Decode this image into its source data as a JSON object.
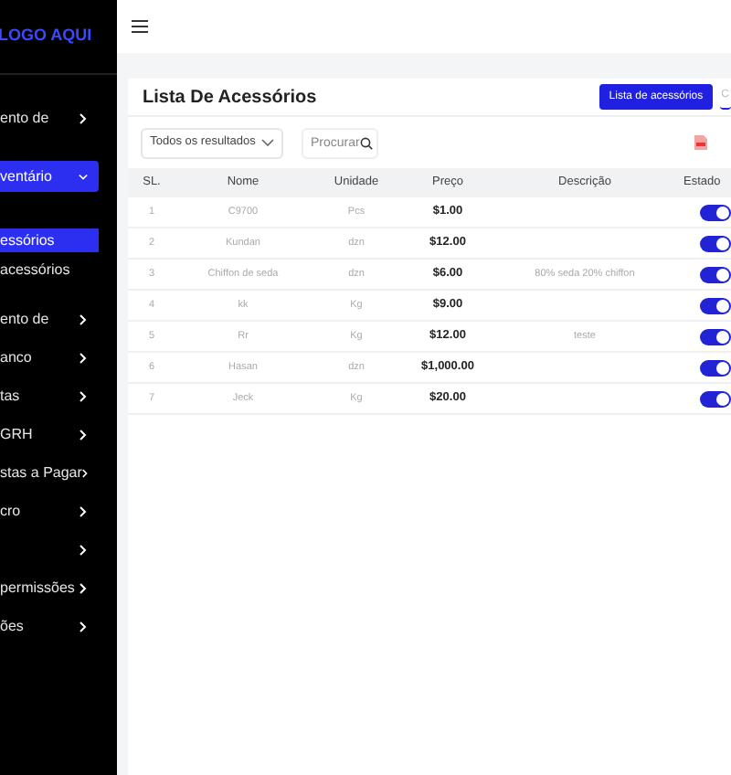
{
  "sidebar": {
    "logo": "LOGO AQUI",
    "items": [
      {
        "label": "ento de",
        "selected": false,
        "expanded": false
      },
      {
        "label": "ventário",
        "selected": true,
        "expanded": true,
        "children": [
          {
            "label": "essórios",
            "selected": true
          },
          {
            "label": "acessórios",
            "selected": false
          }
        ]
      },
      {
        "label": "ento de",
        "selected": false,
        "expanded": false
      },
      {
        "label": "anco",
        "selected": false,
        "expanded": false
      },
      {
        "label": "tas",
        "selected": false,
        "expanded": false
      },
      {
        "label": "GRH",
        "selected": false,
        "expanded": false
      },
      {
        "label": "stas a Pagar",
        "selected": false,
        "expanded": false
      },
      {
        "label": "cro",
        "selected": false,
        "expanded": false
      },
      {
        "selected": false,
        "expanded": false
      },
      {
        "label": "permissões",
        "selected": false,
        "expanded": false
      },
      {
        "label": "ões",
        "selected": false,
        "expanded": false
      }
    ]
  },
  "card": {
    "title": "Lista De Acessórios",
    "tabs": [
      {
        "label": "Lista de acessórios",
        "selected": true
      },
      {
        "label": "C",
        "selected": false
      }
    ],
    "filter": {
      "value": "Todos os resultados"
    },
    "search": {
      "placeholder": "Procurar"
    },
    "table": {
      "columns": [
        "SL.",
        "Nome",
        "Unidade",
        "Preço",
        "Descrição",
        "Estado"
      ],
      "rows": [
        {
          "sl": "1",
          "name": "C9700",
          "unit": "Pcs",
          "price": "$1.00",
          "description": "",
          "on": true
        },
        {
          "sl": "2",
          "name": "Kundan",
          "unit": "dzn",
          "price": "$12.00",
          "description": "",
          "on": true
        },
        {
          "sl": "3",
          "name": "Chiffon de seda",
          "unit": "dzn",
          "price": "$6.00",
          "description": "80% seda 20% chiffon",
          "on": true
        },
        {
          "sl": "4",
          "name": "kk",
          "unit": "Kg",
          "price": "$9.00",
          "description": "",
          "on": true
        },
        {
          "sl": "5",
          "name": "Rr",
          "unit": "Kg",
          "price": "$12.00",
          "description": "teste",
          "on": true
        },
        {
          "sl": "6",
          "name": "Hasan",
          "unit": "dzn",
          "price": "$1,000.00",
          "description": "",
          "on": true
        },
        {
          "sl": "7",
          "name": "Jeck",
          "unit": "Kg",
          "price": "$20.00",
          "description": "",
          "on": true
        }
      ]
    }
  }
}
